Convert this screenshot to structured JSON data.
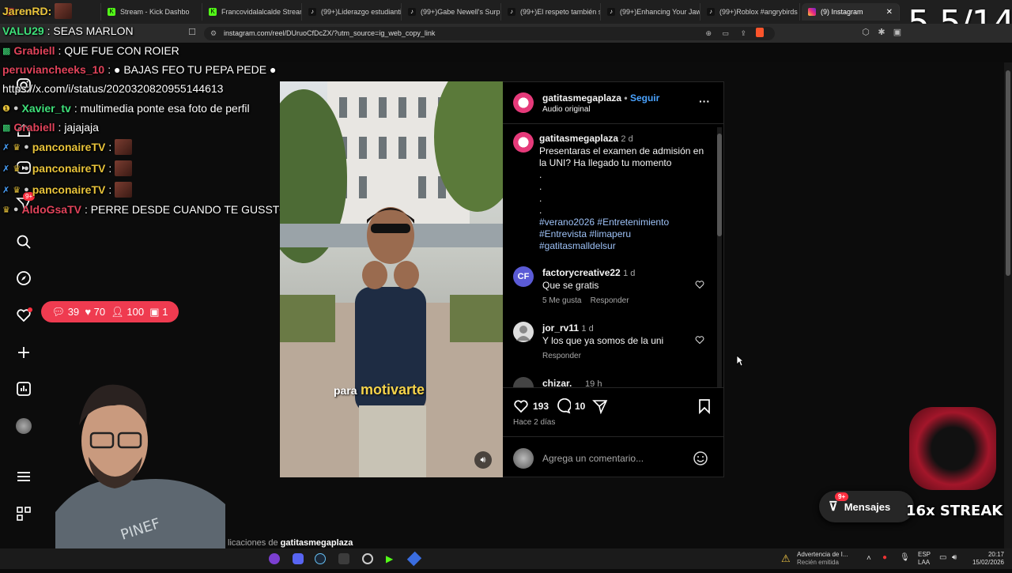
{
  "timer": "5.5/14",
  "browser": {
    "tabs": [
      {
        "label": "JarenRD:",
        "icon": "app-icon"
      },
      {
        "label": "Stream - Kick Dashbo",
        "icon": "kick-icon"
      },
      {
        "label": "Francovidalalcalde Stream",
        "icon": "kick-icon"
      },
      {
        "label": "(99+)Liderazgo estudiantil",
        "icon": "tiktok-icon"
      },
      {
        "label": "(99+)Gabe Newell's Surp",
        "icon": "tiktok-icon"
      },
      {
        "label": "(99+)El respeto también s",
        "icon": "tiktok-icon"
      },
      {
        "label": "(99+)Enhancing Your Jawli",
        "icon": "tiktok-icon"
      },
      {
        "label": "(99+)Roblox #angrybirds",
        "icon": "tiktok-icon"
      },
      {
        "label": "(9) Instagram",
        "icon": "instagram-icon"
      }
    ],
    "url": "instagram.com/reel/DUruoCfDcZX/?utm_source=ig_web_copy_link"
  },
  "chat": [
    {
      "user": "VALU29",
      "user_color": "#3fe07a",
      "message": ": SEAS MARLON"
    },
    {
      "user": "Grabiell",
      "user_color": "#e0435a",
      "message": ": QUE FUE CON ROIER"
    },
    {
      "user": "peruviancheeks_10",
      "user_color": "#e0435a",
      "message": ": ● BAJAS FEO TU PEPA PEDE ●"
    },
    {
      "user": "",
      "user_color": "#ffffff",
      "message": "https://x.com/i/status/2020320820955144613"
    },
    {
      "user": "Xavier_tv",
      "user_color": "#3fe07a",
      "message": ": multimedia ponte esa foto de perfil"
    },
    {
      "user": "Grabiell",
      "user_color": "#e0435a",
      "message": ": jajajaja"
    },
    {
      "user": "panconaireTV",
      "user_color": "#e8c33a",
      "message": ":"
    },
    {
      "user": "panconaireTV",
      "user_color": "#e8c33a",
      "message": ":"
    },
    {
      "user": "panconaireTV",
      "user_color": "#e8c33a",
      "message": ":"
    },
    {
      "user": "AldoGsaTV",
      "user_color": "#e0435a",
      "message": ": PERRE DESDE CUANDO TE GUSSTO LA CHICHA https://goo.su/DtDcGh"
    }
  ],
  "stats": {
    "comments": "39",
    "likes": "70",
    "viewers": "100",
    "subs": "1"
  },
  "nav": {
    "notif_badge": "9+"
  },
  "post": {
    "username": "gatitasmegaplaza",
    "follow": "Seguir",
    "audio": "Audio original",
    "caption_user": "gatitasmegaplaza",
    "caption_time": "2 d",
    "caption_text": "Presentaras el examen de admisión en la UNI? Ha llegado tu momento",
    "caption_dots": [
      ".",
      ".",
      ".",
      "."
    ],
    "hashtags": [
      "#verano2026 #Entretenimiento",
      "#Entrevista #limaperu",
      "#gatitasmalldelsur"
    ],
    "comments": [
      {
        "user": "factorycreative22",
        "time": "1 d",
        "text": "Que se gratis",
        "likes": "5 Me gusta",
        "reply": "Responder",
        "avatar_text": "CF"
      },
      {
        "user": "jor_rv11",
        "time": "1 d",
        "text": "Y los que ya somos de la uni",
        "likes": "",
        "reply": "Responder",
        "avatar_text": ""
      },
      {
        "user": "chizar.__",
        "time": "19 h",
        "text": "",
        "likes": "",
        "reply": "",
        "avatar_text": ""
      }
    ],
    "like_count": "193",
    "comment_count": "10",
    "posted": "Hace 2 días",
    "comment_placeholder": "Agrega un comentario...",
    "video_caption_a": "para",
    "video_caption_b": "motivarte"
  },
  "footer_text": "licaciones de ",
  "footer_user": "gatitasmegaplaza",
  "messages": {
    "label": "Mensajes",
    "badge": "9+"
  },
  "streak": "16x STREAK",
  "taskbar": {
    "warning_title": "Advertencia de I...",
    "warning_sub": "Recién emitida",
    "lang_top": "ESP",
    "lang_bottom": "LAA",
    "time": "20:17",
    "date": "15/02/2026"
  }
}
